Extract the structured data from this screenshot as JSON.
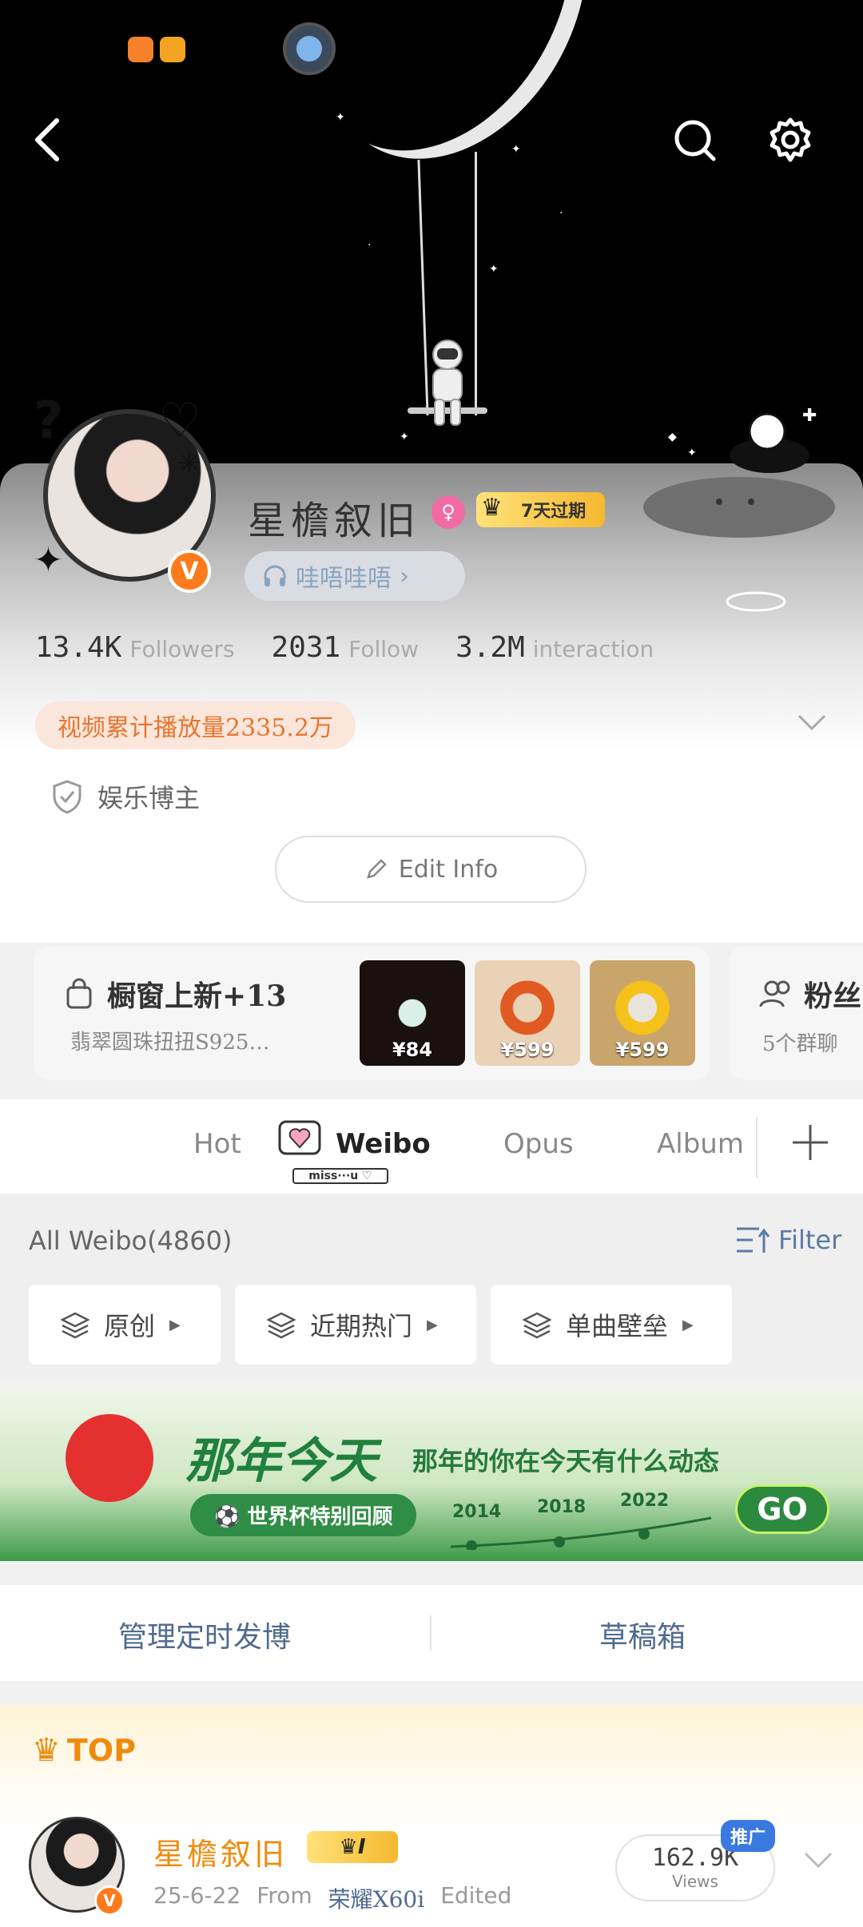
{
  "header": {
    "back_icon": "back-arrow-icon",
    "search_icon": "search-icon",
    "settings_icon": "gear-icon"
  },
  "profile": {
    "name": "星檐叙旧",
    "vip_badge": "7天过期",
    "sub_pill": "哇唔哇唔",
    "stats": [
      {
        "value": "13.4K",
        "label": "Followers"
      },
      {
        "value": "2031",
        "label": "Follow"
      },
      {
        "value": "3.2M",
        "label": "interaction"
      }
    ],
    "play_count": "视频累计播放量2335.2万",
    "verify_label": "娱乐博主",
    "edit_button": "Edit Info"
  },
  "shop": {
    "title": "橱窗上新+13",
    "subtitle": "翡翠圆珠扭扭S925…",
    "products": [
      {
        "price": "¥84"
      },
      {
        "price": "¥599"
      },
      {
        "price": "¥599"
      }
    ]
  },
  "fans_group": {
    "title": "粉丝",
    "subtitle": "5个群聊"
  },
  "tabs": {
    "items": [
      "Hot",
      "Weibo",
      "Opus",
      "Album"
    ],
    "active": "Weibo",
    "active_sticker": "miss···u ♡"
  },
  "filter": {
    "all_label": "All  Weibo(4860)",
    "filter_label": "Filter",
    "chips": [
      "原创",
      "近期热门",
      "单曲壁垒"
    ]
  },
  "banner": {
    "title": "那年今天",
    "subtitle": "那年的你在今天有什么动态",
    "tag": "世界杯特别回顾",
    "years": [
      "2014",
      "2018",
      "2022"
    ],
    "go": "GO"
  },
  "manage": {
    "scheduled": "管理定时发博",
    "drafts": "草稿箱"
  },
  "post": {
    "top_label": "TOP",
    "author": "星檐叙旧",
    "vip_level": "I",
    "date": "25-6-22",
    "from_label": "From",
    "source": "荣耀X60i",
    "edited": "Edited",
    "views_value": "162.9K",
    "views_label": "Views",
    "promo_tag": "推广"
  },
  "colors": {
    "accent_orange": "#f08a0c",
    "link_blue": "#4f6a8f",
    "banner_green": "#21803d"
  }
}
